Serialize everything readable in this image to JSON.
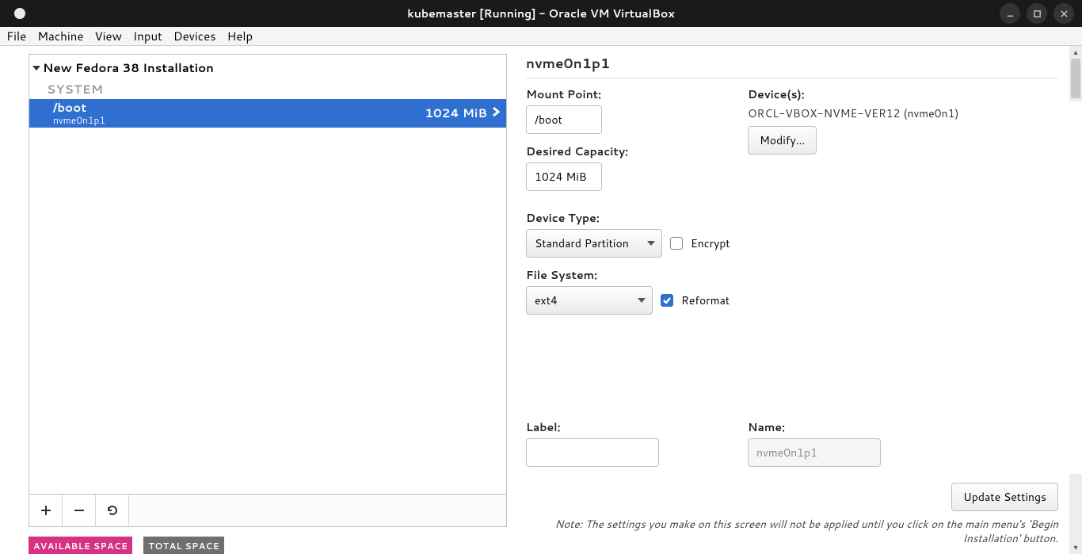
{
  "titlebar": {
    "title": "kubemaster [Running] - Oracle VM VirtualBox"
  },
  "menubar": [
    "File",
    "Machine",
    "View",
    "Input",
    "Devices",
    "Help"
  ],
  "tree": {
    "header": "New Fedora 38 Installation",
    "section": "SYSTEM",
    "item": {
      "mount": "/boot",
      "device": "nvme0n1p1",
      "size": "1024 MiB"
    }
  },
  "space": {
    "avail": "AVAILABLE SPACE",
    "total": "TOTAL SPACE"
  },
  "right": {
    "title": "nvme0n1p1",
    "mount_label": "Mount Point:",
    "mount_value": "/boot",
    "capacity_label": "Desired Capacity:",
    "capacity_value": "1024 MiB",
    "devices_label": "Device(s):",
    "devices_value": "ORCL-VBOX-NVME-VER12 (nvme0n1)",
    "modify": "Modify...",
    "devtype_label": "Device Type:",
    "devtype_value": "Standard Partition",
    "encrypt": "Encrypt",
    "fs_label": "File System:",
    "fs_value": "ext4",
    "reformat": "Reformat",
    "label_label": "Label:",
    "label_value": "",
    "name_label": "Name:",
    "name_value": "nvme0n1p1",
    "update": "Update Settings",
    "note": "Note:  The settings you make on this screen will not be applied until you click on the main menu's 'Begin Installation' button."
  }
}
